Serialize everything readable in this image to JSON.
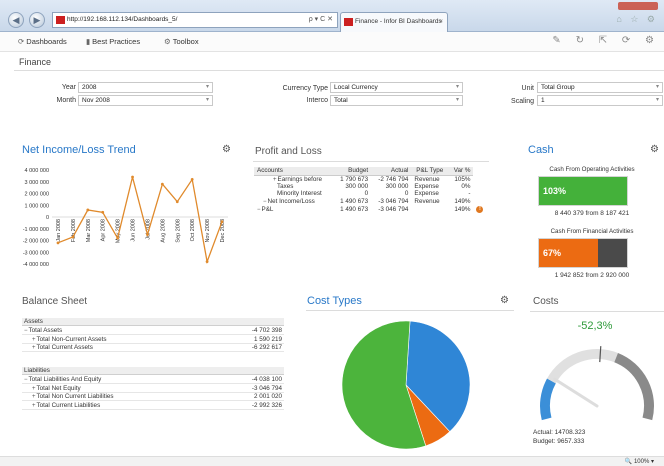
{
  "browser": {
    "address": "http://192.168.112.134/Dashboards_5/",
    "address_tools": "ρ ▾ C ✕",
    "tab_title": "Finance - Infor BI Dashboards",
    "tab_close": "×",
    "right_icons": "⌂ ☆ ⚙"
  },
  "app_nav": [
    {
      "icon": "dashboards-icon",
      "glyph": "⟳",
      "label": "Dashboards"
    },
    {
      "icon": "best-practices-icon",
      "glyph": "▮",
      "label": "Best Practices"
    },
    {
      "icon": "toolbox-icon",
      "glyph": "⚙",
      "label": "Toolbox"
    }
  ],
  "toolbar_icons": "✎ ↻ ⇱ ⟳ ⚙",
  "page_title": "Finance",
  "filters": {
    "year": {
      "label": "Year",
      "value": "2008"
    },
    "month": {
      "label": "Month",
      "value": "Nov 2008"
    },
    "currency_type": {
      "label": "Currency Type",
      "value": "Local Currency"
    },
    "interco": {
      "label": "Interco",
      "value": "Total"
    },
    "unit": {
      "label": "Unit",
      "value": "Total Group"
    },
    "scaling": {
      "label": "Scaling",
      "value": "1"
    }
  },
  "net_income": {
    "title": "Net Income/Loss Trend",
    "chart_data": {
      "type": "line",
      "categories": [
        "Jan 2008",
        "Feb 2008",
        "Mar 2008",
        "Apr 2008",
        "May 2008",
        "Jun 2008",
        "Jul 2008",
        "Aug 2008",
        "Sep 2008",
        "Oct 2008",
        "Nov 2008",
        "Dec 2008"
      ],
      "series": [
        {
          "values": [
            -2200000,
            -1700000,
            600000,
            400000,
            -1800000,
            3400000,
            -1500000,
            2800000,
            1300000,
            3200000,
            -3800000,
            -400000
          ]
        }
      ],
      "yticks": [
        "4 000 000",
        "3 000 000",
        "2 000 000",
        "1 000 000",
        "0",
        "-1 000 000",
        "-2 000 000",
        "-3 000 000",
        "-4 000 000"
      ],
      "ylim": [
        -4000000,
        4000000
      ],
      "color": "#e08a2c",
      "grid": false
    }
  },
  "pnl": {
    "title": "Profit and Loss",
    "headers": [
      "Accounts",
      "Budget",
      "Actual",
      "P&L Type",
      "Var %"
    ],
    "rows": [
      {
        "exp": "+",
        "account": "Earnings before",
        "budget": "1 790 673",
        "actual": "-2 746 794",
        "type": "Revenue",
        "var": "105%",
        "indent": 16
      },
      {
        "exp": "",
        "account": "Taxes",
        "budget": "300 000",
        "actual": "300 000",
        "type": "Expense",
        "var": "0%",
        "indent": 20
      },
      {
        "exp": "",
        "account": "Minority Interest",
        "budget": "0",
        "actual": "0",
        "type": "Expense",
        "var": "-",
        "indent": 20
      },
      {
        "exp": "−",
        "account": "Net Income/Loss",
        "budget": "1 490 673",
        "actual": "-3 046 794",
        "type": "Revenue",
        "var": "149%",
        "indent": 6
      },
      {
        "exp": "−",
        "account": "P&L",
        "budget": "1 490 673",
        "actual": "-3 046 794",
        "type": "",
        "var": "149%",
        "indent": 0,
        "warn": "!"
      }
    ]
  },
  "cash": {
    "title": "Cash",
    "operating": {
      "label": "Cash From Operating Activities",
      "pct": "103%",
      "fill": 1.03,
      "text": "8 440 379 from 8 187 421",
      "color": "#44b13a"
    },
    "financial": {
      "label": "Cash From Financial Activities",
      "pct": "67%",
      "fill": 0.67,
      "text": "1 942 852 from 2 920 000",
      "color": "#ec6b12"
    }
  },
  "balance": {
    "title": "Balance Sheet",
    "assets_header": "Assets",
    "assets": [
      {
        "exp": "−",
        "label": "Total Assets",
        "value": "-4 702 398",
        "indent": 0
      },
      {
        "exp": "+",
        "label": "Total Non-Current Assets",
        "value": "1 590 219",
        "indent": 8
      },
      {
        "exp": "+",
        "label": "Total Current Assets",
        "value": "-6 292 617",
        "indent": 8
      }
    ],
    "liab_header": "Liabilities",
    "liabilities": [
      {
        "exp": "−",
        "label": "Total Liabilities And Equity",
        "value": "-4 038 100",
        "indent": 0
      },
      {
        "exp": "+",
        "label": "Total Net Equity",
        "value": "-3 046 794",
        "indent": 8
      },
      {
        "exp": "+",
        "label": "Total Non Current Liabilities",
        "value": "2 001 020",
        "indent": 8
      },
      {
        "exp": "+",
        "label": "Total Current Liabilities",
        "value": "-2 992 326",
        "indent": 8
      }
    ]
  },
  "cost_types": {
    "title": "Cost Types",
    "chart_data": {
      "type": "pie",
      "values": [
        56,
        37,
        7
      ],
      "colors": [
        "#4cb43c",
        "#2f86d6",
        "#ec6b12"
      ]
    }
  },
  "costs": {
    "title": "Costs",
    "pct": "-52,3%",
    "actual": "Actual: 14708.323",
    "budget": "Budget: 9657.333",
    "gauge": {
      "level": 0.18,
      "colors": [
        "#3b8fd8",
        "#e0e0e0",
        "#8a8a8a"
      ]
    }
  },
  "zoom": "🔍 100% ▾"
}
